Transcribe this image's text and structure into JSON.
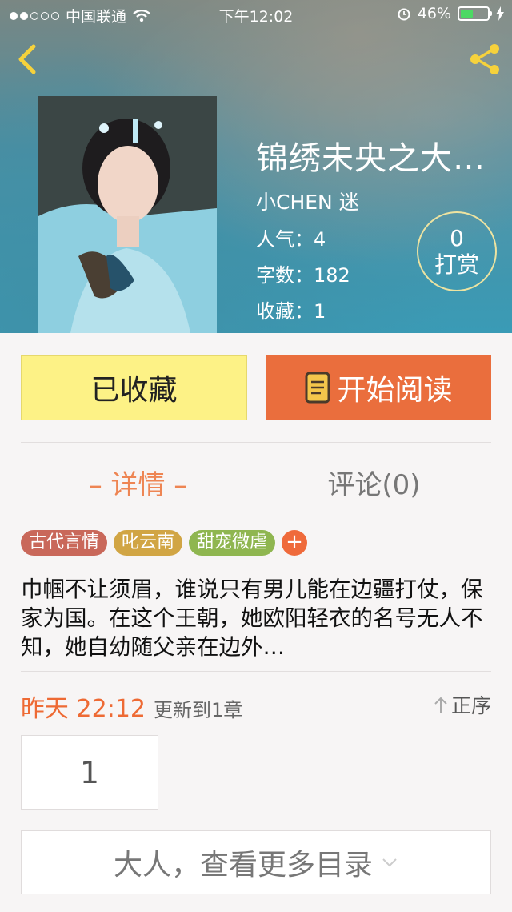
{
  "status_bar": {
    "carrier": "中国联通",
    "time": "下午12:02",
    "battery_percent": "46%",
    "battery_level": 0.46
  },
  "nav": {
    "back_icon": "chevron-left-icon",
    "share_icon": "share-icon"
  },
  "book": {
    "title": "锦绣未央之大…",
    "author": "小CHEN 迷",
    "popularity": "人气：4",
    "word_count": "字数：182",
    "favorites": "收藏：1"
  },
  "reward": {
    "count": "0",
    "label": "打赏"
  },
  "actions": {
    "favorite_label": "已收藏",
    "read_label": "开始阅读"
  },
  "tabs": {
    "detail": "– 详情 –",
    "comments": "评论(0)"
  },
  "tags": [
    {
      "label": "古代言情",
      "color": "#c9685a"
    },
    {
      "label": "叱云南",
      "color": "#d1a544"
    },
    {
      "label": "甜宠微虐",
      "color": "#8fb650"
    }
  ],
  "tag_add": "+",
  "description": "巾帼不让须眉，谁说只有男儿能在边疆打仗，保家为国。在这个王朝，她欧阳轻衣的名号无人不知，她自幼随父亲在边外…",
  "update": {
    "time": "昨天 22:12",
    "text": "更新到1章"
  },
  "sort": {
    "label": "正序"
  },
  "chapters": [
    "1"
  ],
  "more_catalog": "大人，查看更多目录",
  "colors": {
    "accent": "#ea6e3d",
    "favorite_bg": "#fdf286"
  }
}
